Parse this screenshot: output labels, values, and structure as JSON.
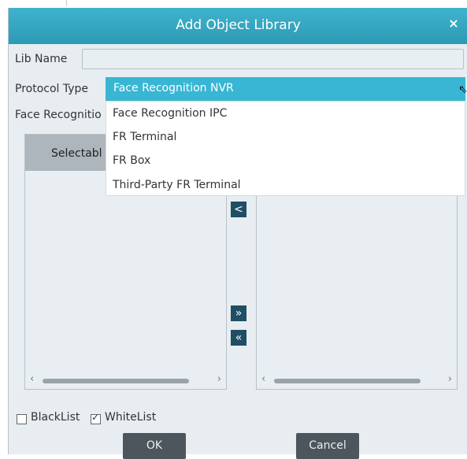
{
  "dialog": {
    "title": "Add Object Library",
    "close_icon": "×"
  },
  "form": {
    "lib_name_label": "Lib Name",
    "lib_name_value": "",
    "protocol_type_label": "Protocol Type",
    "face_recognition_label": "Face Recognitio"
  },
  "protocol_select": {
    "selected": "Face Recognition NVR",
    "options": [
      "Face Recognition IPC",
      "FR Terminal",
      "FR Box",
      "Third-Party FR Terminal"
    ]
  },
  "left_panel": {
    "header": "Selectabl"
  },
  "transfer_buttons": {
    "move_left": "<",
    "move_all_right": "»",
    "move_all_left": "«"
  },
  "options": {
    "blacklist_label": "BlackList",
    "blacklist_checked": false,
    "whitelist_label": "WhiteList",
    "whitelist_checked": true
  },
  "footer": {
    "ok_label": "OK",
    "cancel_label": "Cancel"
  },
  "colors": {
    "title_bar": "#3fb3cd",
    "selected_option": "#38b6d4",
    "dialog_bg": "#e7edf0",
    "button_bg": "#4d565c",
    "transfer_button_bg": "#1f4e65"
  }
}
